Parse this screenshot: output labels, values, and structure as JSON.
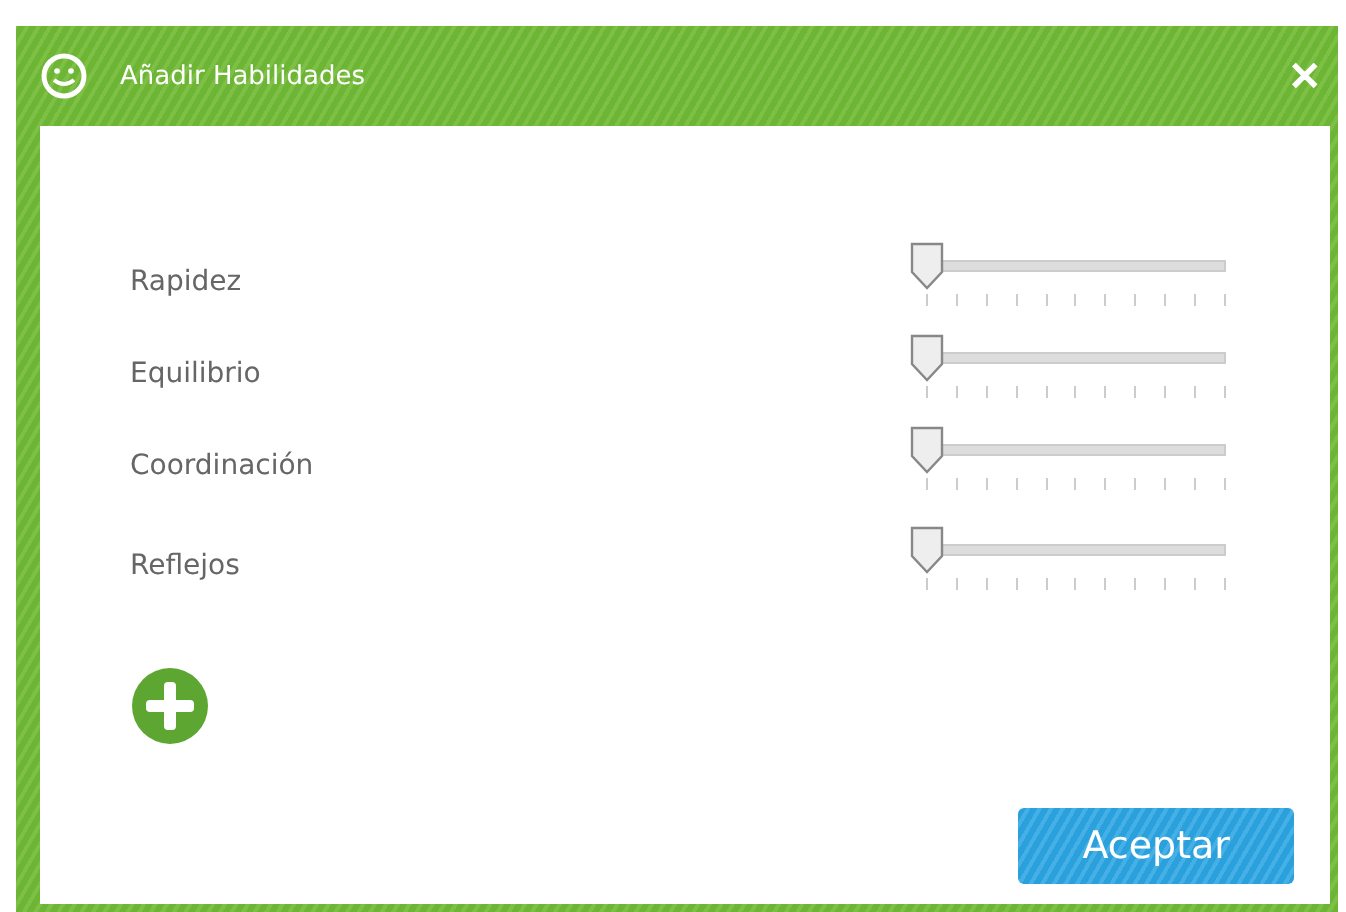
{
  "window": {
    "title": "Añadir Habilidades",
    "close": "✕"
  },
  "skills": [
    {
      "name": "Rapidez",
      "level": 0
    },
    {
      "name": "Equilibrio",
      "level": 0
    },
    {
      "name": "Coordinación",
      "level": 0
    },
    {
      "name": "Reflejos",
      "level": 0
    }
  ],
  "buttons": [
    {
      "label": "Aceptar"
    }
  ]
}
